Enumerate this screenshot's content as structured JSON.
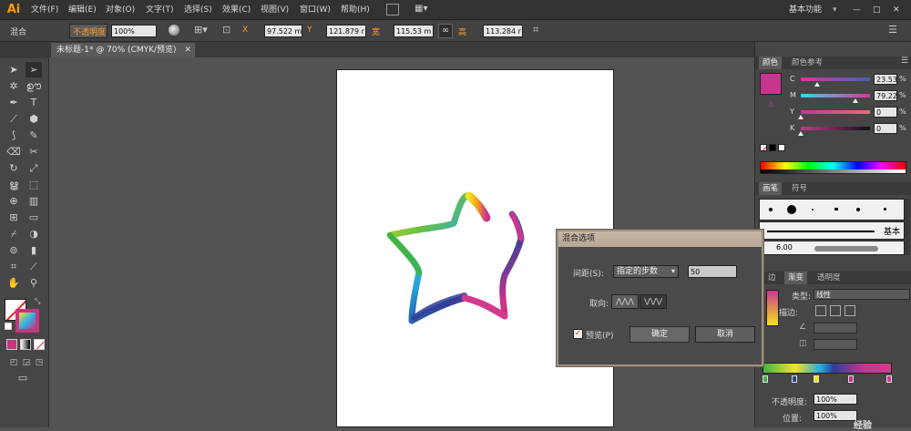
{
  "app": {
    "logo": "Ai",
    "menus": [
      "文件(F)",
      "编辑(E)",
      "对象(O)",
      "文字(T)",
      "选择(S)",
      "效果(C)",
      "视图(V)",
      "窗口(W)",
      "帮助(H)"
    ],
    "workspace": "基本功能",
    "window_controls": [
      "—",
      "□",
      "✕"
    ]
  },
  "control_bar": {
    "mode_label": "混合",
    "opacity_label": "不透明度",
    "opacity_value": "100%",
    "x_label": "X",
    "x_value": "97.522 m",
    "y_label": "Y",
    "y_value": "121.879 r",
    "w_label": "宽",
    "w_value": "115.53 m",
    "h_label": "高",
    "h_value": "113.284 r"
  },
  "document": {
    "tab_title": "未标题-1* @ 70% (CMYK/预览)",
    "tab_close": "✕"
  },
  "color_panel": {
    "tabs": [
      "颜色",
      "颜色参考"
    ],
    "fill_color": "#c8358f",
    "sliders": [
      {
        "label": "C",
        "value": "23.53",
        "fraction": 0.235,
        "gradient": "linear-gradient(90deg,#d6399a,#3f63b4)"
      },
      {
        "label": "M",
        "value": "79.22",
        "fraction": 0.792,
        "gradient": "linear-gradient(90deg,#3fd0f0,#d8369a)"
      },
      {
        "label": "Y",
        "value": "0",
        "fraction": 0,
        "gradient": "linear-gradient(90deg,#c8358f,#e66e7a)"
      },
      {
        "label": "K",
        "value": "0",
        "fraction": 0,
        "gradient": "linear-gradient(90deg,#c8358f,#111)"
      }
    ]
  },
  "brush_panel": {
    "tabs": [
      "画笔",
      "符号"
    ],
    "basic_label": "基本",
    "size_label": "6.00"
  },
  "gradient_panel": {
    "tabs": [
      "边",
      "渐变",
      "透明度"
    ],
    "type_label": "类型:",
    "type_value": "线性",
    "stroke_label": "描边:",
    "opacity_label": "不透明度:",
    "opacity_value": "100%",
    "position_label": "位置:",
    "position_value": "100%"
  },
  "blend_dialog": {
    "title": "混合选项",
    "spacing_label": "间距(S):",
    "spacing_option": "指定的步数",
    "steps_value": "50",
    "orientation_label": "取向:",
    "preview_label": "预览(P)",
    "preview_checked": true,
    "ok_label": "确定",
    "cancel_label": "取消"
  },
  "watermark": "经验"
}
